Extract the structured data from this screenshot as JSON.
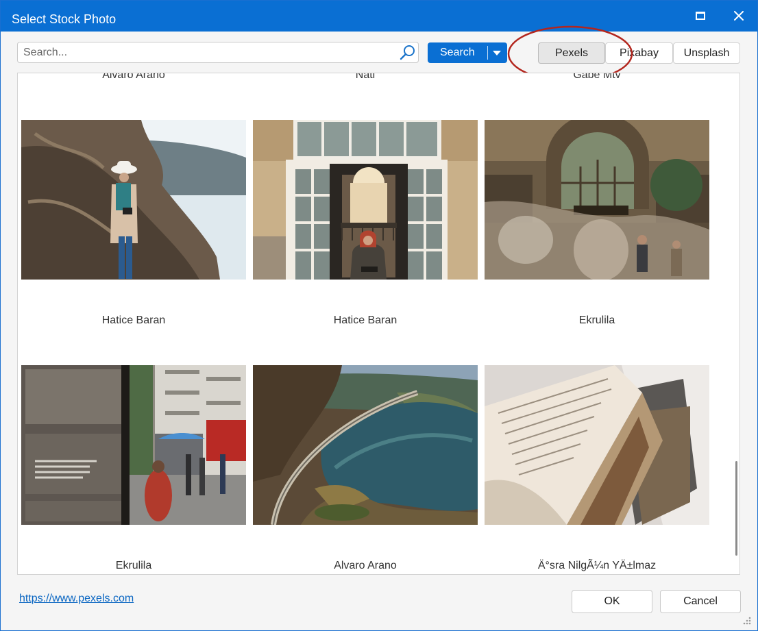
{
  "window": {
    "title": "Select Stock Photo",
    "maximize_icon": "maximize-icon",
    "close_icon": "close-icon"
  },
  "search": {
    "placeholder": "Search...",
    "value": "",
    "button_label": "Search",
    "icon": "search-icon",
    "dropdown_icon": "caret-down-icon"
  },
  "sources": {
    "selected": "Pexels",
    "items": [
      {
        "label": "Pexels"
      },
      {
        "label": "Pixabay"
      },
      {
        "label": "Unsplash"
      }
    ]
  },
  "gallery": {
    "top_row_authors": [
      "Alvaro Arano",
      "Nati",
      "Gabe Mtv"
    ],
    "photos": [
      {
        "author": "Hatice Baran",
        "subject": "woman with camera on rocky coast"
      },
      {
        "author": "Hatice Baran",
        "subject": "woman seated in doorway"
      },
      {
        "author": "Ekrulila",
        "subject": "busy street before ornate facade"
      },
      {
        "author": "Ekrulila",
        "subject": "street scene through glass door"
      },
      {
        "author": "Alvaro Arano",
        "subject": "aerial view of river and road"
      },
      {
        "author": "Ä°sra NilgÃ¼n YÄ±lmaz",
        "subject": "open old books"
      }
    ]
  },
  "footer": {
    "link": "https://www.pexels.com",
    "ok_label": "OK",
    "cancel_label": "Cancel"
  },
  "colors": {
    "accent": "#0a6fd3",
    "annotation": "#b3261e"
  }
}
